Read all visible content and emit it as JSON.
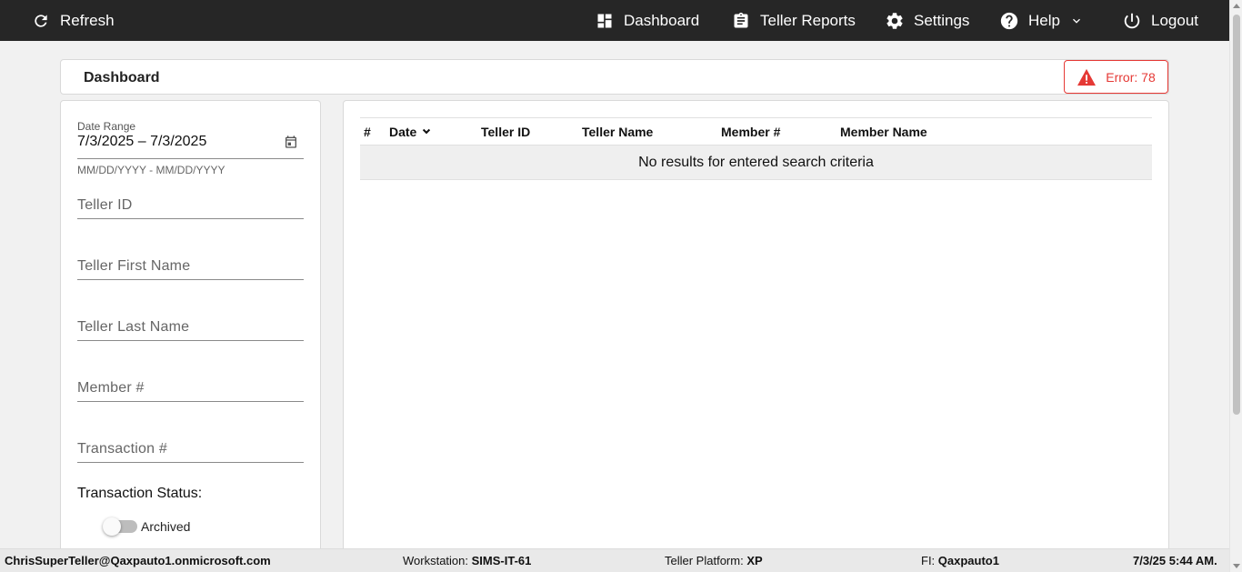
{
  "topbar": {
    "refresh_label": "Refresh",
    "dashboard_label": "Dashboard",
    "teller_reports_label": "Teller Reports",
    "settings_label": "Settings",
    "help_label": "Help",
    "logout_label": "Logout",
    "icons": [
      "refresh-icon",
      "dashboard-icon",
      "clipboard-icon",
      "gear-icon",
      "help-circle-icon",
      "chevron-down-icon",
      "power-icon"
    ]
  },
  "header": {
    "title": "Dashboard",
    "error_label": "Error: 78",
    "error_color": "#e53935"
  },
  "filters": {
    "date_range_label": "Date Range",
    "date_range_value": "7/3/2025 – 7/3/2025",
    "date_range_hint": "MM/DD/YYYY - MM/DD/YYYY",
    "teller_id_placeholder": "Teller ID",
    "teller_first_name_placeholder": "Teller First Name",
    "teller_last_name_placeholder": "Teller Last Name",
    "member_number_placeholder": "Member #",
    "transaction_number_placeholder": "Transaction #",
    "transaction_status_label": "Transaction Status:",
    "archived_label": "Archived",
    "archived_on": false
  },
  "table": {
    "columns": [
      "#",
      "Date",
      "Teller ID",
      "Teller Name",
      "Member #",
      "Member Name"
    ],
    "empty_message": "No results for entered search criteria",
    "sorted_column": "Date"
  },
  "statusbar": {
    "user": "ChrisSuperTeller@Qaxpauto1.onmicrosoft.com",
    "workstation_label": "Workstation:",
    "workstation_value": "SIMS-IT-61",
    "platform_label": "Teller Platform:",
    "platform_value": "XP",
    "fi_label": "FI:",
    "fi_value": "Qaxpauto1",
    "timestamp": "7/3/25 5:44 AM."
  },
  "colors": {
    "topbar_bg": "#262626",
    "accent": "#3f51b5",
    "error": "#e53935"
  }
}
